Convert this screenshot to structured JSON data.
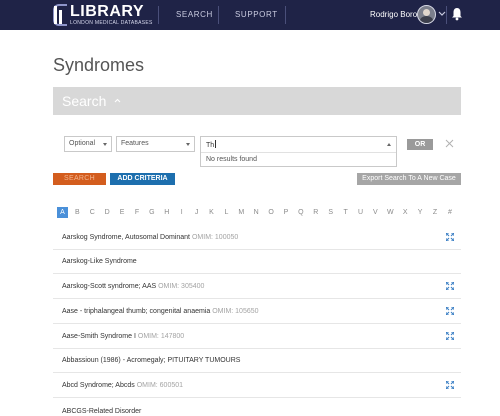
{
  "header": {
    "logo_title": "LIBRARY",
    "logo_subtitle": "LONDON MEDICAL DATABASES",
    "nav": [
      "SEARCH",
      "SUPPORT"
    ],
    "user_name": "Rodrigo Boro",
    "colors": {
      "background": "#1f2347"
    }
  },
  "page_title": "Syndromes",
  "search": {
    "label": "Search",
    "criteria": {
      "operator": "Optional",
      "field": "Features",
      "query": "Th",
      "dropdown_message": "No results found",
      "or_label": "OR"
    },
    "buttons": {
      "search": "SEARCH",
      "add_criteria": "ADD CRITERIA",
      "export": "Export Search To A New Case"
    }
  },
  "alphabet": {
    "letters": [
      "A",
      "B",
      "C",
      "D",
      "E",
      "F",
      "G",
      "H",
      "I",
      "J",
      "K",
      "L",
      "M",
      "N",
      "O",
      "P",
      "Q",
      "R",
      "S",
      "T",
      "U",
      "V",
      "W",
      "X",
      "Y",
      "Z",
      "#"
    ],
    "active": "A"
  },
  "results": [
    {
      "name": "Aarskog Syndrome, Autosomal Dominant",
      "omim": "OMIM: 100050"
    },
    {
      "name": "Aarskog-Like Syndrome",
      "omim": ""
    },
    {
      "name": "Aarskog-Scott syndrome; AAS",
      "omim": "OMIM: 305400"
    },
    {
      "name": "Aase - triphalangeal thumb; congenital anaemia",
      "omim": "OMIM: 105650"
    },
    {
      "name": "Aase-Smith Syndrome I",
      "omim": "OMIM: 147800"
    },
    {
      "name": "Abbassioun (1986) - Acromegaly; PITUITARY TUMOURS",
      "omim": ""
    },
    {
      "name": "Abcd Syndrome; Abcds",
      "omim": "OMIM: 600501"
    },
    {
      "name": "ABCGS-Related Disorder",
      "omim": ""
    }
  ]
}
